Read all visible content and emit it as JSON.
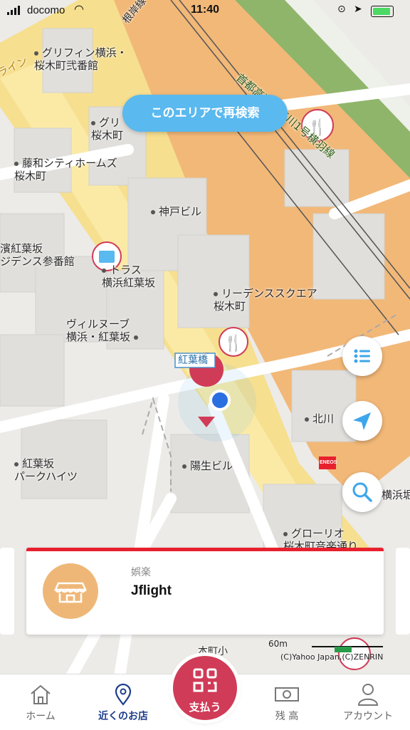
{
  "status_bar": {
    "carrier": "docomo",
    "time": "11:40"
  },
  "map": {
    "labels": [
      {
        "text": "グリフィン横浜・\n桜木町弐番館"
      },
      {
        "text": "グリ\n桜木町"
      },
      {
        "text": "藤和シティホームズ\n桜木町"
      },
      {
        "text": "神戸ビル"
      },
      {
        "text": "濱紅葉坂\nジデンス参番館"
      },
      {
        "text": "トラス\n横浜紅葉坂"
      },
      {
        "text": "リーデンススクエア\n桜木町"
      },
      {
        "text": "ヴィルヌーブ\n横浜・紅葉坂"
      },
      {
        "text": "紅葉橋"
      },
      {
        "text": "北川"
      },
      {
        "text": "紅葉坂\nパークハイツ"
      },
      {
        "text": "陽生ビル"
      },
      {
        "text": "横浜堀"
      },
      {
        "text": "グローリオ\n桜木町音楽通り"
      },
      {
        "text": "本町小"
      },
      {
        "text": "ライン"
      },
      {
        "text": "根岸線"
      },
      {
        "text": "首都高速神奈川1号横羽線"
      },
      {
        "text": "ENEOS"
      }
    ],
    "scale": "60m",
    "attribution": "(C)Yahoo Japan,(C)ZENRIN"
  },
  "research_button": {
    "label": "このエリアで再検索"
  },
  "shop_card": {
    "category": "娯楽",
    "name": "Jflight",
    "accent_color": "#e8202e"
  },
  "tabs": [
    {
      "label": "ホーム",
      "icon": "home-icon"
    },
    {
      "label": "近くのお店",
      "icon": "location-pin-icon"
    },
    {
      "label": "支払う",
      "icon": "qr-code-icon"
    },
    {
      "label": "残 高",
      "icon": "money-bill-icon"
    },
    {
      "label": "アカウント",
      "icon": "user-icon"
    }
  ]
}
